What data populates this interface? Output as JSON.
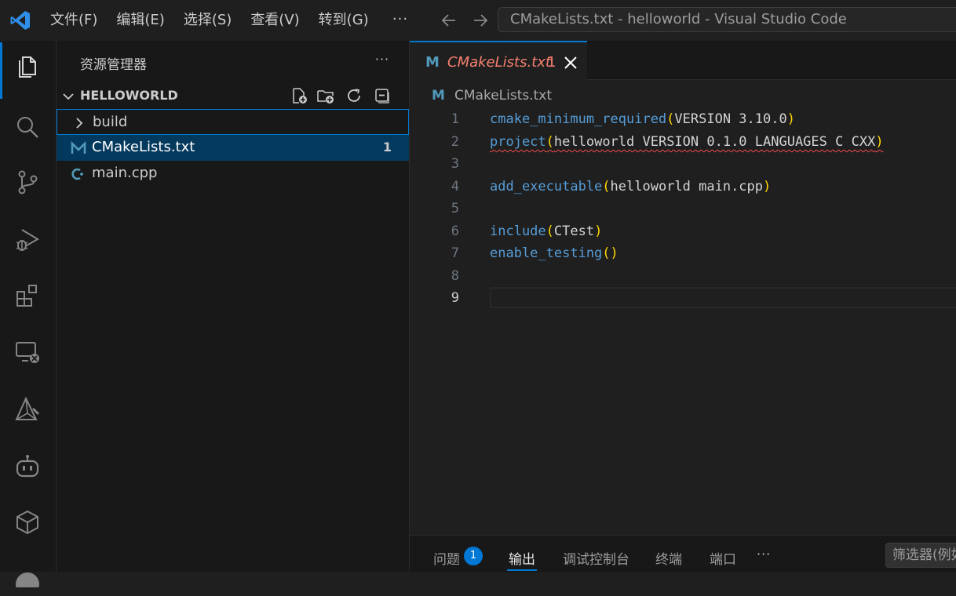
{
  "window": {
    "title": "CMakeLists.txt - helloworld - Visual Studio Code"
  },
  "menu": [
    "文件(F)",
    "编辑(E)",
    "选择(S)",
    "查看(V)",
    "转到(G)"
  ],
  "menu_more": "···",
  "activity_bar": [
    "explorer-icon",
    "search-icon",
    "source-control-icon",
    "run-debug-icon",
    "extensions-icon",
    "remote-explorer-icon",
    "cmake-icon",
    "copilot-icon",
    "package-icon",
    "accounts-icon"
  ],
  "sidebar": {
    "title": "资源管理器",
    "more": "···",
    "folder": "HELLOWORLD",
    "items": [
      {
        "label": "build",
        "type": "folder"
      },
      {
        "label": "CMakeLists.txt",
        "type": "cmake-file",
        "badge": "1"
      },
      {
        "label": "main.cpp",
        "type": "cpp-file"
      }
    ]
  },
  "editor": {
    "tab": {
      "label": "CMakeLists.txt",
      "badge": "1",
      "icon": "M"
    },
    "breadcrumb": {
      "icon": "M",
      "file": "CMakeLists.txt"
    },
    "current_line": 9,
    "lines": [
      {
        "n": "1",
        "fn": "cmake_minimum_required",
        "open": "(",
        "args": "VERSION 3.10.0",
        "close": ")"
      },
      {
        "n": "2",
        "fn": "project",
        "open": "(",
        "args": "helloworld VERSION 0.1.0 LANGUAGES C CXX",
        "close": ")"
      },
      {
        "n": "3",
        "fn": "",
        "open": "",
        "args": "",
        "close": ""
      },
      {
        "n": "4",
        "fn": "add_executable",
        "open": "(",
        "args": "helloworld main.cpp",
        "close": ")"
      },
      {
        "n": "5",
        "fn": "",
        "open": "",
        "args": "",
        "close": ""
      },
      {
        "n": "6",
        "fn": "include",
        "open": "(",
        "args": "CTest",
        "close": ")"
      },
      {
        "n": "7",
        "fn": "enable_testing",
        "open": "(",
        "args": "",
        "close": ")"
      },
      {
        "n": "8",
        "fn": "",
        "open": "",
        "args": "",
        "close": ""
      },
      {
        "n": "9",
        "fn": "",
        "open": "",
        "args": "",
        "close": ""
      }
    ]
  },
  "panel": {
    "tabs": [
      "问题",
      "输出",
      "调试控制台",
      "终端",
      "端口"
    ],
    "problems_badge": "1",
    "active_tab": "输出",
    "more": "···",
    "filter_placeholder": "筛选器(例如"
  },
  "colors": {
    "accent": "#0078d4",
    "error_tab": "#f88070",
    "keyword": "#569cd6",
    "bracket": "#ffd700",
    "cmake_icon": "#519aba"
  }
}
